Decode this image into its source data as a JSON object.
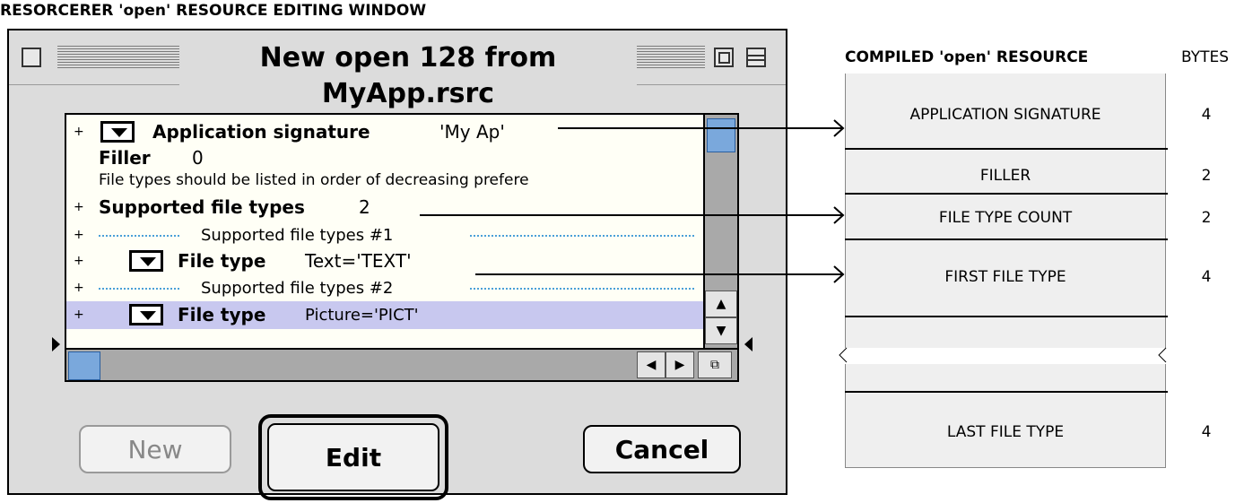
{
  "heading": "RESORCERER 'open' RESOURCE EDITING WINDOW",
  "window": {
    "title": "New open 128 from MyApp.rsrc",
    "rows": [
      {
        "label": "Application signature",
        "value": "'My Ap'"
      },
      {
        "label": "Filler",
        "value": "0"
      },
      {
        "note": "File types should be listed in order of decreasing prefere"
      },
      {
        "label": "Supported file types",
        "value": "2"
      },
      {
        "separator": "Supported file types #1"
      },
      {
        "label": "File type",
        "value": "Text='TEXT'"
      },
      {
        "separator": "Supported file types #2"
      },
      {
        "label": "File type",
        "value": "Picture='PICT'"
      }
    ],
    "buttons": {
      "new": "New",
      "edit": "Edit",
      "cancel": "Cancel"
    }
  },
  "resource": {
    "heading": "COMPILED 'open' RESOURCE",
    "bytes_heading": "BYTES",
    "fields": [
      {
        "name": "APPLICATION SIGNATURE",
        "bytes": "4"
      },
      {
        "name": "FILLER",
        "bytes": "2"
      },
      {
        "name": "FILE TYPE COUNT",
        "bytes": "2"
      },
      {
        "name": "FIRST FILE TYPE",
        "bytes": "4"
      },
      {
        "name": "LAST FILE TYPE",
        "bytes": "4"
      }
    ]
  },
  "colors": {
    "window_bg": "#dcdcdc",
    "list_bg": "#fffff6",
    "selection": "#c8c8ef",
    "scroll_thumb": "#7aa8dc",
    "resource_bg": "#efefef"
  }
}
